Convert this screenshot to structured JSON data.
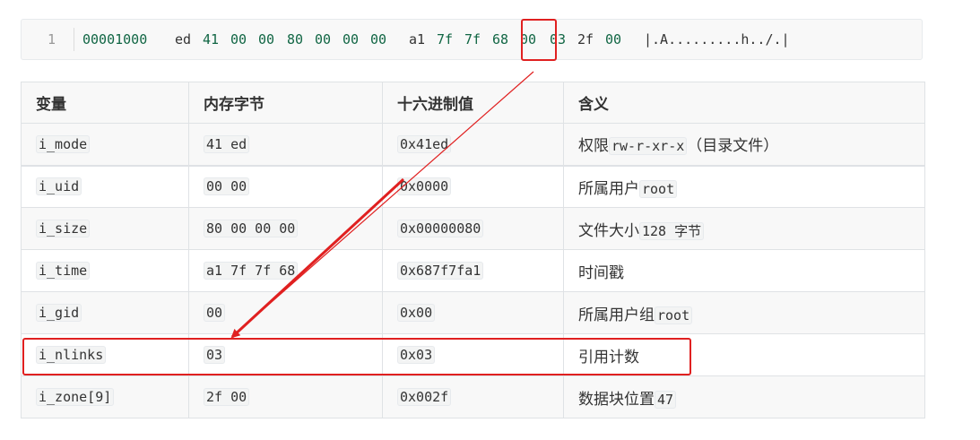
{
  "code_block": {
    "line_number": "1",
    "tokens": [
      {
        "text": "00001000",
        "kind": "num"
      },
      {
        "text": "ed",
        "kind": "var"
      },
      {
        "text": "41",
        "kind": "num"
      },
      {
        "text": "00",
        "kind": "num"
      },
      {
        "text": "00",
        "kind": "num"
      },
      {
        "text": "80",
        "kind": "num"
      },
      {
        "text": "00",
        "kind": "num"
      },
      {
        "text": "00",
        "kind": "num"
      },
      {
        "text": "00",
        "kind": "num"
      },
      {
        "text": "a1",
        "kind": "var"
      },
      {
        "text": "7f",
        "kind": "num"
      },
      {
        "text": "7f",
        "kind": "num"
      },
      {
        "text": "68",
        "kind": "num"
      },
      {
        "text": "00",
        "kind": "num"
      },
      {
        "text": "03",
        "kind": "num"
      },
      {
        "text": "2f",
        "kind": "var"
      },
      {
        "text": "00",
        "kind": "num"
      },
      {
        "text": "|.A.........h../.|",
        "kind": "ascii"
      }
    ],
    "highlighted_byte": "03"
  },
  "table": {
    "headers": [
      "变量",
      "内存字节",
      "十六进制值",
      "含义"
    ],
    "rows": [
      {
        "var": "i_mode",
        "bytes": "41 ed",
        "hex": "0x41ed",
        "meaning": "权限",
        "meaning_code": "rw-r-xr-x",
        "meaning_suffix": "（目录文件）"
      },
      {
        "var": "i_uid",
        "bytes": "00 00",
        "hex": "0x0000",
        "meaning": "所属用户",
        "meaning_code": "root",
        "meaning_suffix": ""
      },
      {
        "var": "i_size",
        "bytes": "80 00 00 00",
        "hex": "0x00000080",
        "meaning": "文件大小",
        "meaning_code": "128 字节",
        "meaning_suffix": ""
      },
      {
        "var": "i_time",
        "bytes": "a1 7f 7f 68",
        "hex": "0x687f7fa1",
        "meaning": "时间戳",
        "meaning_code": "",
        "meaning_suffix": ""
      },
      {
        "var": "i_gid",
        "bytes": "00",
        "hex": "0x00",
        "meaning": "所属用户组",
        "meaning_code": "root",
        "meaning_suffix": ""
      },
      {
        "var": "i_nlinks",
        "bytes": "03",
        "hex": "0x03",
        "meaning": "引用计数",
        "meaning_code": "",
        "meaning_suffix": "",
        "highlighted": true
      },
      {
        "var": "i_zone[9]",
        "bytes": "2f 00",
        "hex": "0x002f",
        "meaning": "数据块位置",
        "meaning_code": "47",
        "meaning_suffix": ""
      }
    ]
  },
  "annotation": {
    "color": "#e02020",
    "description_target": "i_nlinks"
  }
}
